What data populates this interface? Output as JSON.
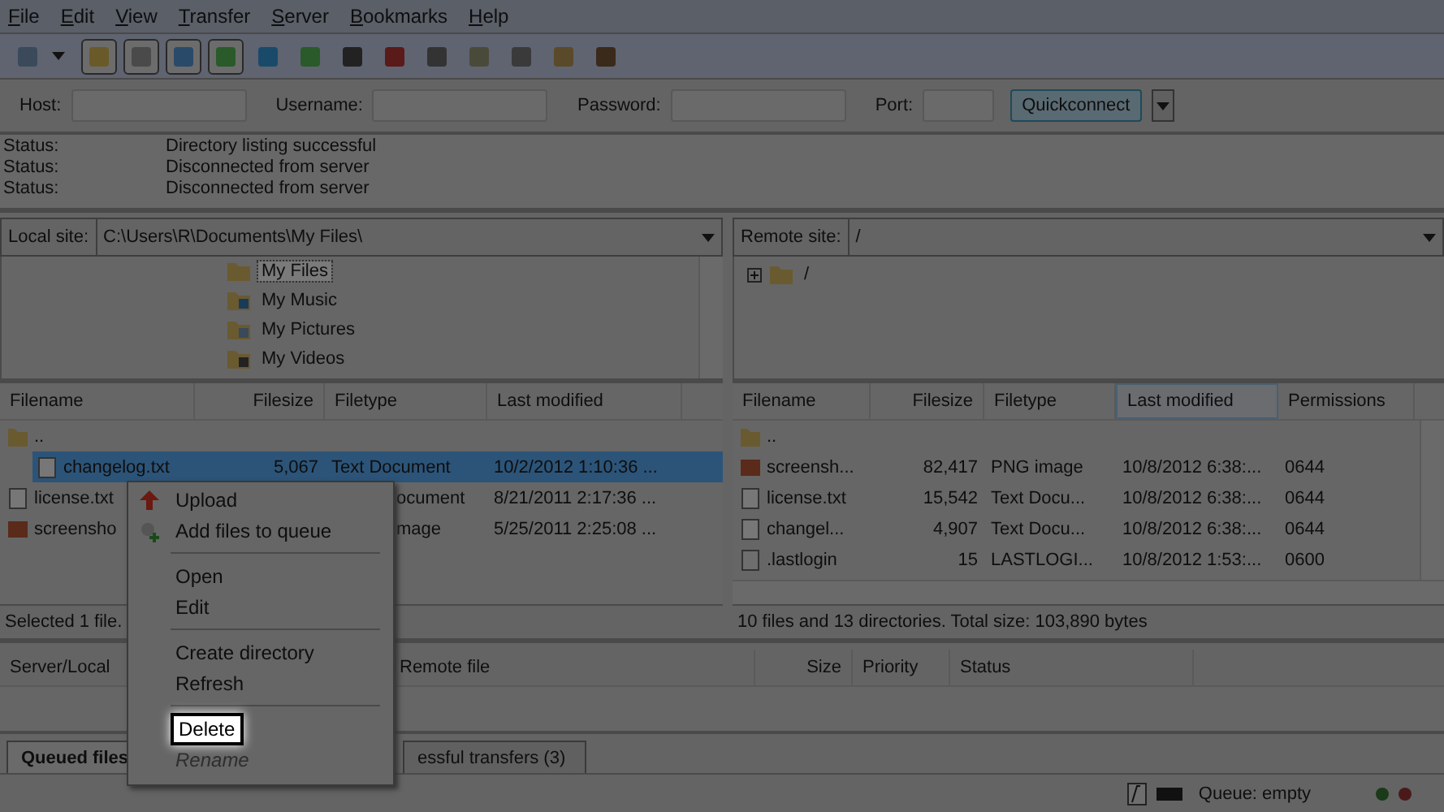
{
  "menu": [
    "File",
    "Edit",
    "View",
    "Transfer",
    "Server",
    "Bookmarks",
    "Help"
  ],
  "toolbar": [
    {
      "pressed": false
    },
    {
      "pressed": true
    },
    {
      "pressed": true
    },
    {
      "pressed": true
    },
    {
      "pressed": true
    },
    {
      "pressed": false
    },
    {
      "pressed": false
    },
    {
      "pressed": false
    },
    {
      "pressed": false
    },
    {
      "pressed": false
    },
    {
      "pressed": false
    },
    {
      "pressed": false
    },
    {
      "pressed": false
    },
    {
      "pressed": false
    }
  ],
  "quickconnect": {
    "host": "Host:",
    "username": "Username:",
    "password": "Password:",
    "port": "Port:",
    "button": "Quickconnect"
  },
  "log": [
    {
      "label": "Status:",
      "text": "Directory listing successful"
    },
    {
      "label": "Status:",
      "text": "Disconnected from server"
    },
    {
      "label": "Status:",
      "text": "Disconnected from server"
    }
  ],
  "local": {
    "label": "Local site:",
    "path": "C:\\Users\\R\\Documents\\My Files\\",
    "tree": [
      {
        "label": "My Files",
        "selected": true,
        "kind": "folder"
      },
      {
        "label": "My Music",
        "selected": false,
        "kind": "music"
      },
      {
        "label": "My Pictures",
        "selected": false,
        "kind": "pictures"
      },
      {
        "label": "My Videos",
        "selected": false,
        "kind": "videos"
      }
    ],
    "columns": [
      "Filename",
      "Filesize",
      "Filetype",
      "Last modified"
    ],
    "rows": [
      {
        "kind": "folder",
        "selected": false,
        "cells": [
          "..",
          "",
          "",
          ""
        ]
      },
      {
        "kind": "text",
        "selected": true,
        "cells": [
          "changelog.txt",
          "5,067",
          "Text Document",
          "10/2/2012 1:10:36 ..."
        ]
      },
      {
        "kind": "text",
        "selected": false,
        "cells": [
          "license.txt",
          "",
          "ocument",
          "8/21/2011 2:17:36 ..."
        ]
      },
      {
        "kind": "image",
        "selected": false,
        "cells": [
          "screensho",
          "",
          "mage",
          "5/25/2011 2:25:08 ..."
        ]
      }
    ],
    "status": "Selected 1 file."
  },
  "remote": {
    "label": "Remote site:",
    "path": "/",
    "tree": [
      {
        "label": "/",
        "expanded": false
      }
    ],
    "columns": [
      "Filename",
      "Filesize",
      "Filetype",
      "Last modified",
      "Permissions"
    ],
    "rows": [
      {
        "kind": "folder",
        "selected": false,
        "cells": [
          "..",
          "",
          "",
          "",
          ""
        ]
      },
      {
        "kind": "image",
        "selected": false,
        "cells": [
          "screensh...",
          "82,417",
          "PNG image",
          "10/8/2012 6:38:...",
          "0644"
        ]
      },
      {
        "kind": "text",
        "selected": false,
        "cells": [
          "license.txt",
          "15,542",
          "Text Docu...",
          "10/8/2012 6:38:...",
          "0644"
        ]
      },
      {
        "kind": "text",
        "selected": false,
        "cells": [
          "changel...",
          "4,907",
          "Text Docu...",
          "10/8/2012 6:38:...",
          "0644"
        ]
      },
      {
        "kind": "blank",
        "selected": false,
        "cells": [
          ".lastlogin",
          "15",
          "LASTLOGI...",
          "10/8/2012 1:53:...",
          "0600"
        ]
      }
    ],
    "status": "10 files and 13 directories. Total size: 103,890 bytes"
  },
  "queue": {
    "columns": [
      "Server/Local",
      "Remote file",
      "Size",
      "Priority",
      "Status"
    ]
  },
  "tabs": [
    {
      "label": "Queued files",
      "selected": true
    },
    {
      "label": "essful transfers (3)",
      "selected": false
    }
  ],
  "status_bar": {
    "queue": "Queue: empty"
  },
  "context_menu": [
    {
      "kind": "upload",
      "label": "Upload",
      "selected": false,
      "disabled": false
    },
    {
      "kind": "queue",
      "label": "Add files to queue",
      "selected": false,
      "disabled": false
    },
    {
      "kind": "separator"
    },
    {
      "kind": "item",
      "label": "Open",
      "selected": false,
      "disabled": false
    },
    {
      "kind": "item",
      "label": "Edit",
      "selected": false,
      "disabled": false
    },
    {
      "kind": "separator"
    },
    {
      "kind": "item",
      "label": "Create directory",
      "selected": false,
      "disabled": false
    },
    {
      "kind": "item",
      "label": "Refresh",
      "selected": false,
      "disabled": false
    },
    {
      "kind": "separator"
    },
    {
      "kind": "item",
      "label": "Delete",
      "selected": true,
      "disabled": false
    },
    {
      "kind": "item",
      "label": "Rename",
      "selected": false,
      "disabled": true
    }
  ]
}
